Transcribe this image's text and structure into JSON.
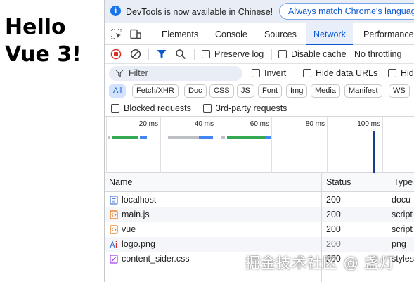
{
  "page": {
    "heading_lines": [
      "Hello",
      "Vue 3!"
    ]
  },
  "devtools": {
    "info_bar": {
      "icon": "info-icon",
      "message": "DevTools is now available in Chinese!",
      "button_label": "Always match Chrome's language"
    },
    "tabs": [
      {
        "label": "Elements",
        "active": false
      },
      {
        "label": "Console",
        "active": false
      },
      {
        "label": "Sources",
        "active": false
      },
      {
        "label": "Network",
        "active": true
      },
      {
        "label": "Performance",
        "active": false
      }
    ],
    "toolbar_icons": [
      "inspect-element-icon",
      "device-toolbar-icon"
    ],
    "network_toolbar": {
      "icons": [
        "record-stop-icon",
        "clear-icon",
        "filter-icon",
        "search-icon"
      ],
      "preserve_log": "Preserve log",
      "disable_cache": "Disable cache",
      "throttling": "No throttling"
    },
    "filter_bar": {
      "placeholder": "Filter",
      "invert": "Invert",
      "hide_data_urls": "Hide data URLs",
      "hide_extension_urls": "Hid"
    },
    "type_filters": [
      "All",
      "Fetch/XHR",
      "Doc",
      "CSS",
      "JS",
      "Font",
      "Img",
      "Media",
      "Manifest",
      "WS"
    ],
    "blocked_row": {
      "blocked_requests": "Blocked requests",
      "third_party_requests": "3rd-party requests"
    },
    "overview": {
      "ticks": [
        "20 ms",
        "40 ms",
        "60 ms",
        "80 ms",
        "100 ms"
      ],
      "bar_colors": {
        "waiting": "#34a853",
        "queued": "#bdc1c6",
        "download": "#4285f4",
        "marker": "#1a3c8f"
      }
    },
    "columns": [
      "Name",
      "Status",
      "Type"
    ],
    "requests": [
      {
        "name": "localhost",
        "status": "200",
        "type": "docu",
        "icon": "document-icon",
        "status_dim": false
      },
      {
        "name": "main.js",
        "status": "200",
        "type": "script",
        "icon": "script-icon",
        "status_dim": false
      },
      {
        "name": "vue",
        "status": "200",
        "type": "script",
        "icon": "script-icon",
        "status_dim": false
      },
      {
        "name": "logo.png",
        "status": "200",
        "type": "png",
        "icon": "image-icon",
        "status_dim": true
      },
      {
        "name": "content_sider.css",
        "status": "200",
        "type": "styles",
        "icon": "stylesheet-icon",
        "status_dim": false
      }
    ]
  },
  "watermark": "掘金技术社区 @ 盏灯",
  "colors": {
    "accent": "#0b57d0",
    "record_red": "#d93025",
    "info_bar_bg": "#e9eef6"
  }
}
